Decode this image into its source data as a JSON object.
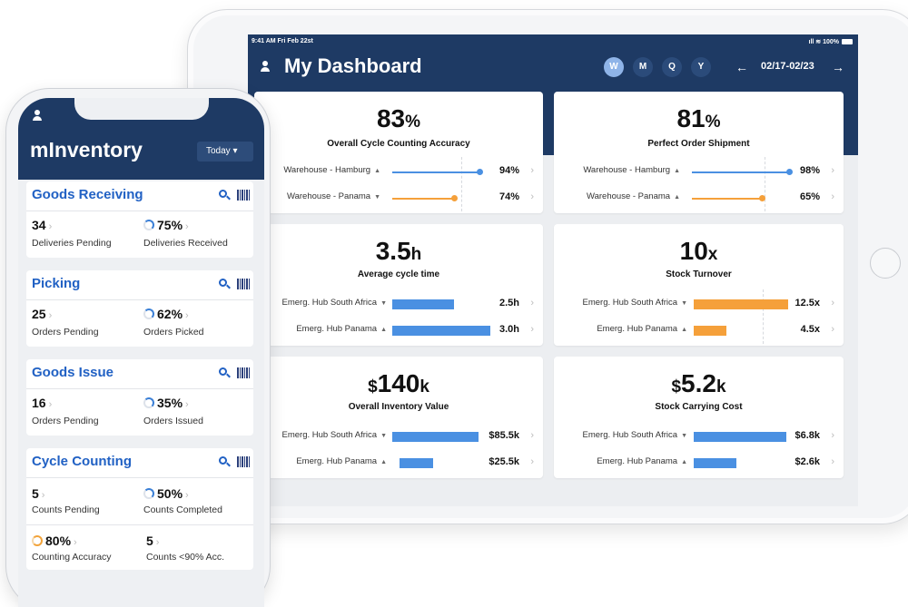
{
  "tablet": {
    "status": {
      "time": "9:41 AM  Fri Feb 22st",
      "right": "100%"
    },
    "title": "My Dashboard",
    "periods": [
      "W",
      "M",
      "Q",
      "Y"
    ],
    "date_range": "02/17-02/23",
    "prev_arrow": "←",
    "next_arrow": "→",
    "cards": [
      {
        "value": "83",
        "unit": "%",
        "subtitle": "Overall Cycle Counting Accuracy",
        "rows": [
          {
            "label": "Warehouse - Hamburg",
            "trend": "▲",
            "value": "94%",
            "fraction": 0.94
          },
          {
            "label": "Warehouse - Panama",
            "trend": "▼",
            "value": "74%",
            "fraction": 0.74
          }
        ]
      },
      {
        "value": "81",
        "unit": "%",
        "subtitle": "Perfect Order Shipment",
        "rows": [
          {
            "label": "Warehouse - Hamburg",
            "trend": "▲",
            "value": "98%",
            "fraction": 0.98
          },
          {
            "label": "Warehouse - Panama",
            "trend": "▲",
            "value": "65%",
            "fraction": 0.65
          }
        ]
      },
      {
        "value": "3.5",
        "unit": "h",
        "subtitle": "Average cycle time",
        "rows": [
          {
            "label": "Emerg. Hub South Africa",
            "trend": "▼",
            "value": "2.5h",
            "fraction": 0.46
          },
          {
            "label": "Emerg. Hub Panama",
            "trend": "▲",
            "value": "3.0h",
            "fraction": 0.97
          }
        ]
      },
      {
        "value": "10",
        "unit": "x",
        "subtitle": "Stock Turnover",
        "rows": [
          {
            "label": "Emerg. Hub South Africa",
            "trend": "▼",
            "value": "12.5x",
            "fraction": 1.0
          },
          {
            "label": "Emerg. Hub Panama",
            "trend": "▲",
            "value": "4.5x",
            "fraction": 0.36
          }
        ]
      },
      {
        "prefix": "$",
        "value": "140",
        "unit": "k",
        "subtitle": "Overall Inventory Value",
        "rows": [
          {
            "label": "Emerg. Hub South Africa",
            "trend": "▼",
            "value": "$85.5k",
            "fraction": 1.0
          },
          {
            "label": "Emerg. Hub Panama",
            "trend": "▲",
            "value": "$25.5k",
            "fraction": 0.4
          }
        ]
      },
      {
        "prefix": "$",
        "value": "5.2",
        "unit": "k",
        "subtitle": "Stock Carrying Cost",
        "rows": [
          {
            "label": "Emerg. Hub South Africa",
            "trend": "▼",
            "value": "$6.8k",
            "fraction": 1.0
          },
          {
            "label": "Emerg. Hub Panama",
            "trend": "▲",
            "value": "$2.6k",
            "fraction": 0.46
          }
        ]
      }
    ]
  },
  "phone": {
    "app_name": "mInventory",
    "period_select": "Today ▾",
    "sections": [
      {
        "title": "Goods Receiving",
        "metrics": [
          {
            "value": "34",
            "label": "Deliveries Pending",
            "ring": false
          },
          {
            "value": "75%",
            "label": "Deliveries Received",
            "ring": true,
            "fraction": 0.75
          }
        ]
      },
      {
        "title": "Picking",
        "metrics": [
          {
            "value": "25",
            "label": "Orders Pending",
            "ring": false
          },
          {
            "value": "62%",
            "label": "Orders Picked",
            "ring": true,
            "fraction": 0.62
          }
        ]
      },
      {
        "title": "Goods Issue",
        "metrics": [
          {
            "value": "16",
            "label": "Orders Pending",
            "ring": false
          },
          {
            "value": "35%",
            "label": "Orders Issued",
            "ring": true,
            "fraction": 0.35
          }
        ]
      },
      {
        "title": "Cycle Counting",
        "metrics": [
          {
            "value": "5",
            "label": "Counts Pending",
            "ring": false
          },
          {
            "value": "50%",
            "label": "Counts Completed",
            "ring": true,
            "fraction": 0.5
          },
          {
            "value": "80%",
            "label": "Counting Accuracy",
            "ring": true,
            "fraction": 0.8
          },
          {
            "value": "5",
            "label": "Counts <90% Acc.",
            "ring": false
          }
        ]
      }
    ]
  },
  "colors": {
    "navy": "#1e3a64",
    "blue": "#4a90e2",
    "orange": "#f5a03a",
    "link_blue": "#2161c4"
  }
}
